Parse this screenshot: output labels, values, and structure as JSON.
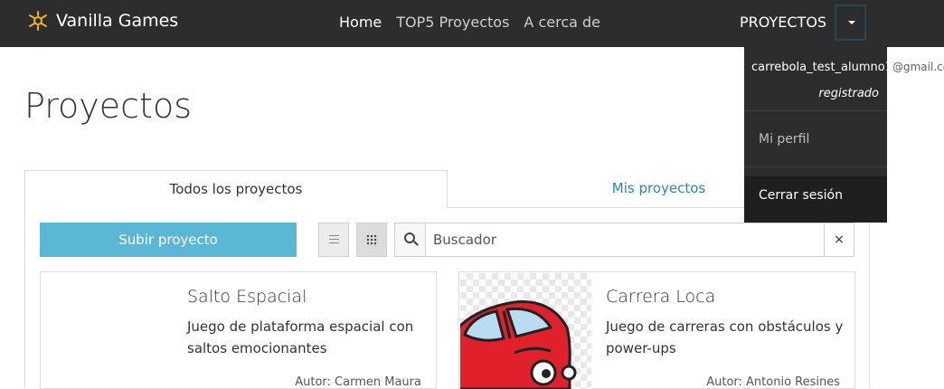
{
  "navbar": {
    "brand": "Vanilla Games",
    "links": [
      "Home",
      "TOP5 Proyectos",
      "A cerca de"
    ],
    "projects_menu": "PROYECTOS"
  },
  "dropdown": {
    "email_user": "carrebola_test_alumno1",
    "email_domain": "@gmail.co",
    "status": "registrado",
    "items": [
      "Mi perfil",
      "Cerrar sesión"
    ]
  },
  "page": {
    "title": "Proyectos",
    "tabs": [
      "Todos los proyectos",
      "Mis proyectos"
    ],
    "upload_button": "Subir proyecto",
    "search_placeholder": "Buscador",
    "clear_symbol": "×"
  },
  "cards": [
    {
      "title": "Salto Espacial",
      "description": "Juego de plataforma espacial con saltos emocionantes",
      "author": "Autor: Carmen Maura"
    },
    {
      "title": "Carrera Loca",
      "description": "Juego de carreras con obstáculos y power-ups",
      "author": "Autor: Antonio Resines"
    }
  ],
  "colors": {
    "navbar": "#2d2d2d",
    "brand_logo": "#f0b323",
    "upload_button": "#5bb7d6",
    "tab_link": "#2a86b8",
    "car_body": "#e0202a"
  }
}
